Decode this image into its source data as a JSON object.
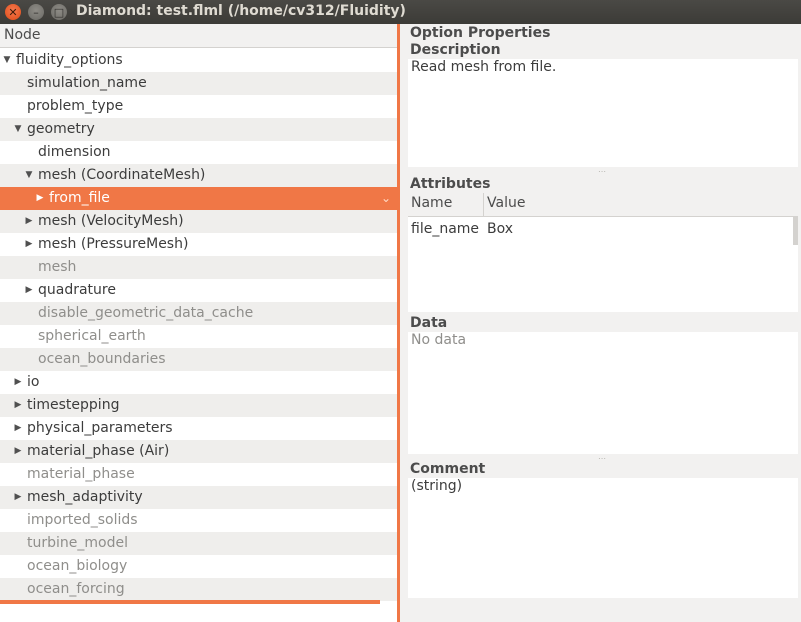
{
  "window": {
    "title": "Diamond: test.flml (/home/cv312/Fluidity)",
    "close_glyph": "✕",
    "minimize_glyph": "–",
    "maximize_glyph": "□"
  },
  "tree": {
    "header": "Node",
    "rows": [
      {
        "label": "fluidity_options",
        "expander": "▼",
        "level": 0,
        "disabled": false
      },
      {
        "label": "simulation_name",
        "expander": "",
        "level": 1,
        "disabled": false
      },
      {
        "label": "problem_type",
        "expander": "",
        "level": 1,
        "disabled": false
      },
      {
        "label": "geometry",
        "expander": "▼",
        "level": 1,
        "disabled": false
      },
      {
        "label": "dimension",
        "expander": "",
        "level": 2,
        "disabled": false
      },
      {
        "label": "mesh (CoordinateMesh)",
        "expander": "▼",
        "level": 2,
        "disabled": false
      },
      {
        "label": "from_file",
        "expander": "▶",
        "level": 3,
        "disabled": false,
        "selected": true
      },
      {
        "label": "mesh (VelocityMesh)",
        "expander": "▶",
        "level": 2,
        "disabled": false
      },
      {
        "label": "mesh (PressureMesh)",
        "expander": "▶",
        "level": 2,
        "disabled": false
      },
      {
        "label": "mesh",
        "expander": "",
        "level": 2,
        "disabled": true
      },
      {
        "label": "quadrature",
        "expander": "▶",
        "level": 2,
        "disabled": false
      },
      {
        "label": "disable_geometric_data_cache",
        "expander": "",
        "level": 2,
        "disabled": true
      },
      {
        "label": "spherical_earth",
        "expander": "",
        "level": 2,
        "disabled": true
      },
      {
        "label": "ocean_boundaries",
        "expander": "",
        "level": 2,
        "disabled": true
      },
      {
        "label": "io",
        "expander": "▶",
        "level": 1,
        "disabled": false
      },
      {
        "label": "timestepping",
        "expander": "▶",
        "level": 1,
        "disabled": false
      },
      {
        "label": "physical_parameters",
        "expander": "▶",
        "level": 1,
        "disabled": false
      },
      {
        "label": "material_phase (Air)",
        "expander": "▶",
        "level": 1,
        "disabled": false
      },
      {
        "label": "material_phase",
        "expander": "",
        "level": 1,
        "disabled": true
      },
      {
        "label": "mesh_adaptivity",
        "expander": "▶",
        "level": 1,
        "disabled": false
      },
      {
        "label": "imported_solids",
        "expander": "",
        "level": 1,
        "disabled": true
      },
      {
        "label": "turbine_model",
        "expander": "",
        "level": 1,
        "disabled": true
      },
      {
        "label": "ocean_biology",
        "expander": "",
        "level": 1,
        "disabled": true
      },
      {
        "label": "ocean_forcing",
        "expander": "",
        "level": 1,
        "disabled": true
      }
    ],
    "selected_chevron": "⌄"
  },
  "properties": {
    "heading": "Option Properties",
    "description": {
      "title": "Description",
      "text": "Read mesh from file."
    },
    "attributes": {
      "title": "Attributes",
      "col_name": "Name",
      "col_value": "Value",
      "row": {
        "name": "file_name",
        "value": "Box"
      }
    },
    "data": {
      "title": "Data",
      "text": "No data"
    },
    "comment": {
      "title": "Comment",
      "text": "(string)"
    },
    "grip": "⋯"
  },
  "colors": {
    "accent": "#f07746",
    "titlebar": "#3c3b37",
    "disabled_text": "#8f8e8b"
  }
}
